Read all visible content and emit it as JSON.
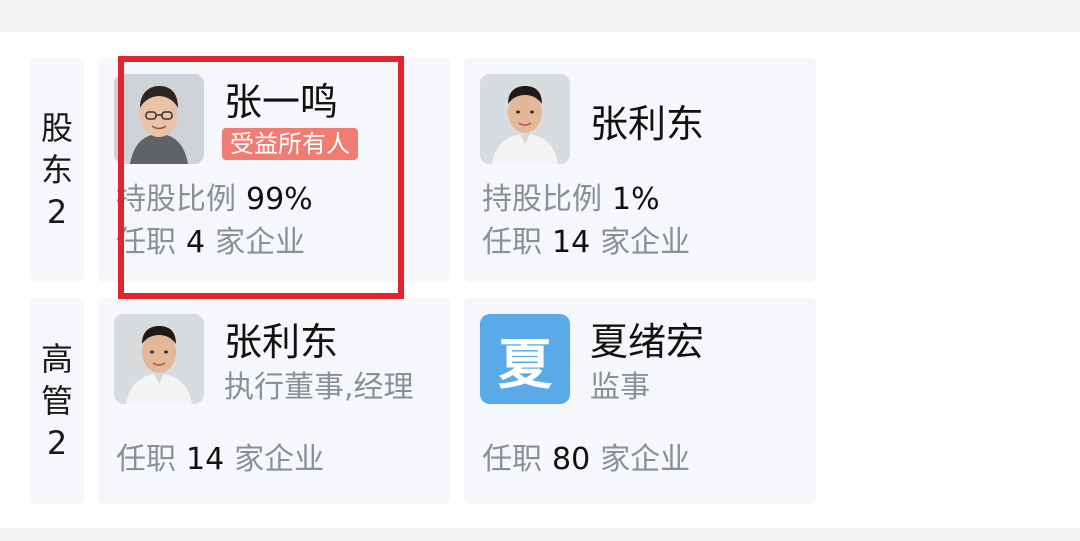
{
  "sections": {
    "shareholders": {
      "label_chars": [
        "股",
        "东",
        "2"
      ]
    },
    "executives": {
      "label_chars": [
        "高",
        "管",
        "2"
      ]
    }
  },
  "shareholders": [
    {
      "name": "张一鸣",
      "badge": "受益所有人",
      "ratio_label": "持股比例",
      "ratio_value": "99%",
      "positions_prefix": "任职",
      "positions_count": "4",
      "positions_suffix": "家企业"
    },
    {
      "name": "张利东",
      "ratio_label": "持股比例",
      "ratio_value": "1%",
      "positions_prefix": "任职",
      "positions_count": "14",
      "positions_suffix": "家企业"
    }
  ],
  "executives": [
    {
      "name": "张利东",
      "role": "执行董事,经理",
      "positions_prefix": "任职",
      "positions_count": "14",
      "positions_suffix": "家企业"
    },
    {
      "name": "夏绪宏",
      "avatar_letter": "夏",
      "role": "监事",
      "positions_prefix": "任职",
      "positions_count": "80",
      "positions_suffix": "家企业"
    }
  ],
  "colors": {
    "highlight": "#e0252c",
    "badge": "#f07c73",
    "letter_avatar": "#5aaae8",
    "card_bg": "#f5f7fb",
    "muted_text": "#8a8f98"
  }
}
